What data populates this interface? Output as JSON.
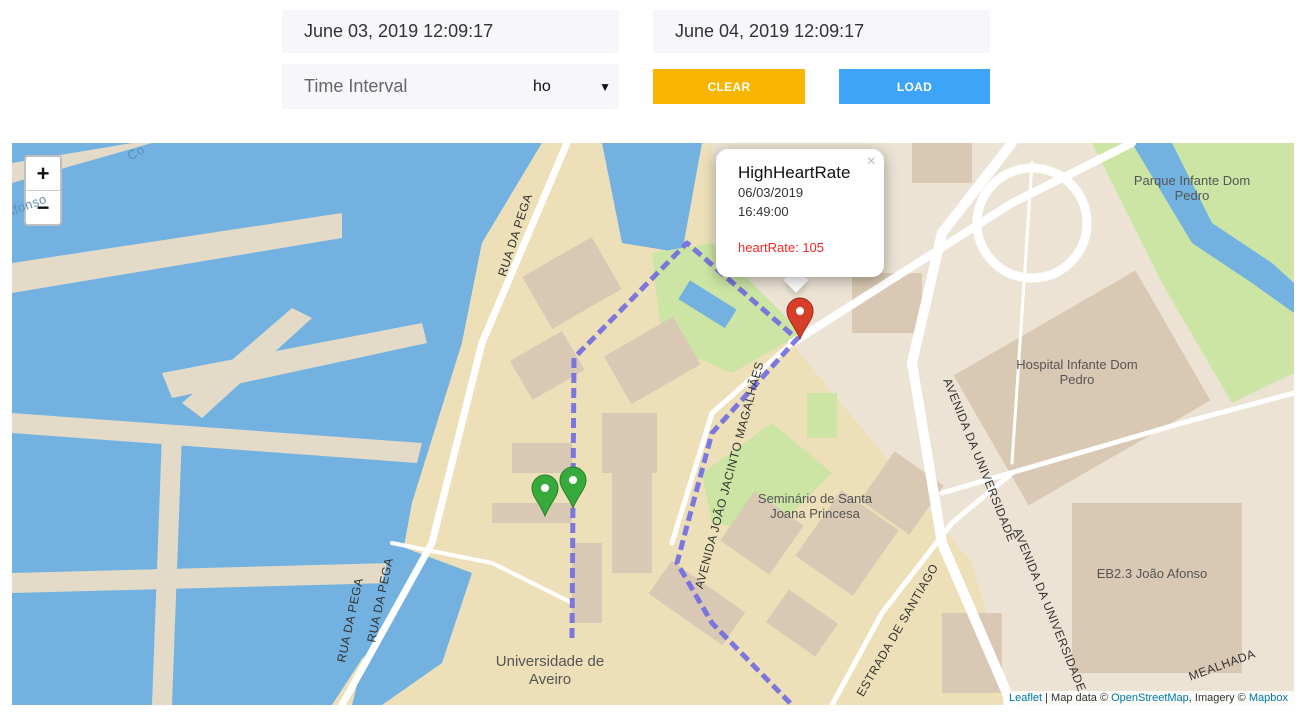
{
  "controls": {
    "start_date": "June 03, 2019 12:09:17",
    "end_date": "June 04, 2019 12:09:17",
    "interval_label": "Time Interval",
    "interval_value": "ho",
    "clear_label": "CLEAR",
    "load_label": "LOAD"
  },
  "map": {
    "zoom_in": "+",
    "zoom_out": "−",
    "labels": {
      "park": "Parque Infante Dom Pedro",
      "hospital": "Hospital Infante Dom Pedro",
      "seminario": "Seminário de Santa Joana Princesa",
      "universidade": "Universidade de Aveiro",
      "school": "EB2.3 João Afonso",
      "rua_pega_1": "RUA DA PEGA",
      "rua_pega_2": "RUA DA PEGA",
      "rua_pega_3": "RUA DA PEGA",
      "avenida_joao": "AVENIDA JOÃO JACINTO MAGALHÃES",
      "avenida_univ_1": "AVENIDA DA UNIVERSIDADE",
      "avenida_univ_2": "AVENIDA DA UNIVERSIDADE",
      "estrada": "ESTRADA DE SANTIAGO",
      "mealhada": "MEALHADA",
      "canal_partial": "Co",
      "street_partial": "Afonso"
    },
    "popup": {
      "title": "HighHeartRate",
      "date": "06/03/2019",
      "time": "16:49:00",
      "alert": "heartRate: 105",
      "close": "×"
    },
    "attribution": {
      "leaflet": "Leaflet",
      "map_data": " | Map data © ",
      "osm": "OpenStreetMap",
      "imagery": ", Imagery © ",
      "mapbox": "Mapbox"
    },
    "markers": [
      {
        "type": "alert",
        "color": "#d63e2a"
      },
      {
        "type": "location",
        "color": "#38aa3b"
      },
      {
        "type": "location",
        "color": "#38aa3b"
      }
    ],
    "route_color": "#6f6ce0",
    "water_color": "#73b2e0",
    "park_color": "#cce5a5"
  }
}
